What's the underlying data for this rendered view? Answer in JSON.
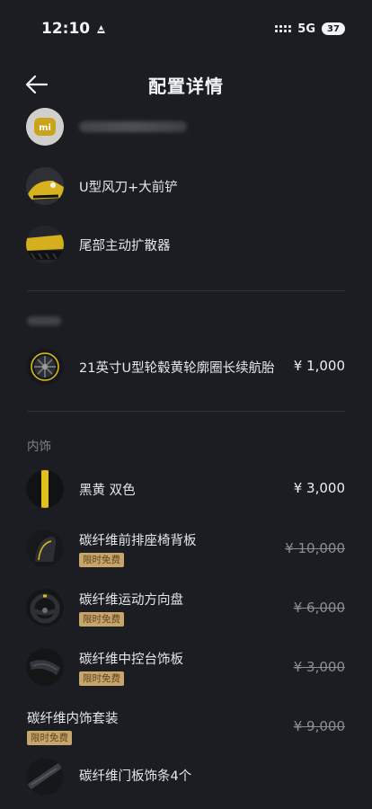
{
  "status_bar": {
    "time": "12:10",
    "network": "5G",
    "battery": "37"
  },
  "header": {
    "title": "配置详情"
  },
  "colors": {
    "background": "#1b1d22",
    "accent_gold": "#c8a56a",
    "yellow": "#e8c21a"
  },
  "exterior_items": [
    {
      "label": "",
      "icon": "xiaomi-logo-icon"
    },
    {
      "label": "U型风刀+大前铲",
      "icon": "front-bumper-icon"
    },
    {
      "label": "尾部主动扩散器",
      "icon": "rear-diffuser-icon"
    }
  ],
  "wheels": {
    "label": "21英寸U型轮毂黄轮廓圈长续航胎",
    "price": "¥ 1,000",
    "icon": "wheel-icon"
  },
  "interior": {
    "section_label": "内饰",
    "items": [
      {
        "label": "黑黄 双色",
        "price": "¥ 3,000",
        "badge": "",
        "icon": "color-swatch-icon"
      },
      {
        "label": "碳纤维前排座椅背板",
        "price": "¥ 10,000",
        "badge": "限时免费",
        "icon": "seat-icon"
      },
      {
        "label": "碳纤维运动方向盘",
        "price": "¥ 6,000",
        "badge": "限时免费",
        "icon": "steering-wheel-icon"
      },
      {
        "label": "碳纤维中控台饰板",
        "price": "¥ 3,000",
        "badge": "限时免费",
        "icon": "console-icon"
      }
    ],
    "package": {
      "label": "碳纤维内饰套装",
      "badge": "限时免费",
      "price": "¥ 9,000"
    },
    "door_trim": {
      "label": "碳纤维门板饰条4个",
      "icon": "door-trim-icon"
    }
  }
}
